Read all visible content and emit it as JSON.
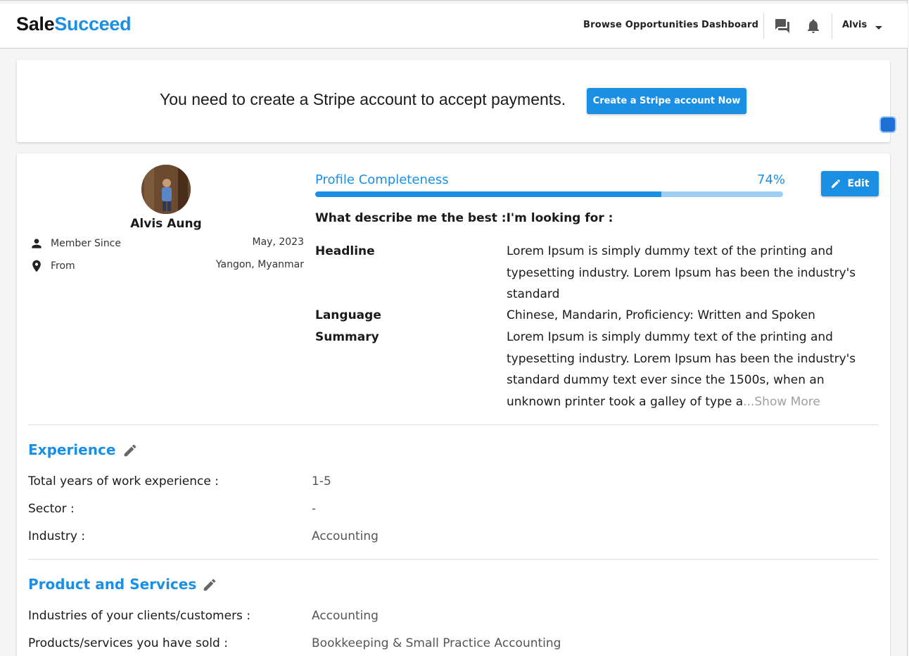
{
  "navbar": {
    "logo_part1": "Sale",
    "logo_part2": "Succeed",
    "browse_label": "Browse Opportunities",
    "dashboard_label": "Dashboard",
    "user_label": "Alvis"
  },
  "banner": {
    "message": "You need to create a Stripe account to accept payments.",
    "button_label": "Create a Stripe account Now"
  },
  "profile": {
    "name": "Alvis Aung",
    "member_since_label": "Member Since",
    "member_since_value": "May, 2023",
    "from_label": "From",
    "from_value": "Yangon, Myanmar",
    "completeness_label": "Profile Completeness",
    "completeness_text": "74%",
    "completeness_value": 0.74,
    "edit_label": "Edit",
    "describe": "What describe me the best :I'm looking for :",
    "headline_label": "Headline",
    "headline_value": "Lorem Ipsum is simply dummy text of the printing and typesetting industry. Lorem Ipsum has been the industry's standard",
    "language_label": "Language",
    "language_value": "Chinese, Mandarin, Proficiency: Written and Spoken",
    "summary_label": "Summary",
    "summary_value": "Lorem Ipsum is simply dummy text of the printing and typesetting industry. Lorem Ipsum has been the industry's standard dummy text ever since the 1500s, when an unknown printer took a galley of type a",
    "summary_ellipsis": "...",
    "show_more": "Show More"
  },
  "experience": {
    "title": "Experience",
    "rows": [
      {
        "label": "Total years of work experience :",
        "value": "1-5"
      },
      {
        "label": "Sector :",
        "value": "-"
      },
      {
        "label": "Industry :",
        "value": "Accounting"
      }
    ]
  },
  "products": {
    "title": "Product and Services",
    "rows": [
      {
        "label": "Industries of your clients/customers :",
        "value": "Accounting"
      },
      {
        "label": "Products/services you have sold :",
        "value": "Bookkeeping & Small Practice Accounting"
      }
    ]
  },
  "colors": {
    "accent": "#1a8fe3",
    "progress_track": "#9ccff3"
  },
  "icons": [
    "chat-icon",
    "bell-icon",
    "chevron-down-icon",
    "person-icon",
    "location-pin-icon",
    "pencil-icon"
  ]
}
